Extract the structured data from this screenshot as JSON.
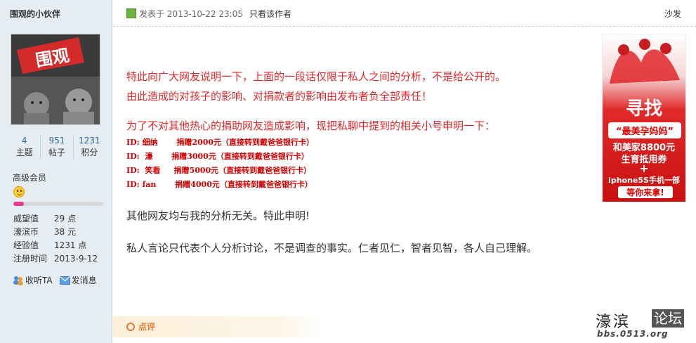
{
  "user": {
    "name": "围观的小伙伴",
    "avatar_text": "围观",
    "stats": [
      {
        "value": "4",
        "label": "主题"
      },
      {
        "value": "951",
        "label": "帖子"
      },
      {
        "value": "1231",
        "label": "积分"
      }
    ],
    "group": "高级会员",
    "level_progress_percent": 12,
    "info": [
      {
        "key": "威望值",
        "value": "29 点"
      },
      {
        "key": "濠滨币",
        "value": "38 元"
      },
      {
        "key": "经验值",
        "value": "1231 点"
      },
      {
        "key": "注册时间",
        "value": "2013-9-12"
      }
    ],
    "actions": {
      "follow": "收听TA",
      "message": "发消息"
    }
  },
  "post": {
    "meta": "发表于 2013-10-22 23:05",
    "only_author": "只看该作者",
    "floor": "沙发",
    "paragraph1": [
      "特此向广大网友说明一下，上面的一段话仅限于私人之间的分析，不是给公开的。",
      "由此造成的对孩子的影响、对捐款者的影响由发布者负全部责任！"
    ],
    "paragraph2": "为了不对其他热心的捐助网友造成影响，现把私聊中提到的相关小号申明一下：",
    "ids": [
      "ID: 细纳       捐赠2000元（直接转到戴爸爸银行卡）",
      "ID:  濠       捐赠3000元（直接转到戴爸爸银行卡）",
      "ID:  笑看     捐赠5000元（直接转到戴爸爸银行卡）",
      "ID: fan       捐赠4000元（直接转到戴爸爸银行卡）"
    ],
    "paragraph3": "其他网友均与我的分析无关。特此申明!",
    "paragraph4": "私人言论只代表个人分析讨论，不是调查的事实。仁者见仁，智者见智，各人自己理解。"
  },
  "ad": {
    "title": "寻找",
    "subtitle": "“最美孕妈妈”",
    "line1": "和美家8800元",
    "line2": "生育抵用券",
    "plus": "+",
    "line3": "iphone5S手机一部",
    "line4": "等你来拿!"
  },
  "reply": {
    "label": "点评"
  },
  "logo": {
    "cn": "濠滨",
    "box": "论坛",
    "url": "bbs.0513.org"
  },
  "colors": {
    "red_text": "#e0282a",
    "sidebar_bg": "#e5edf2",
    "link_blue": "#336699"
  }
}
